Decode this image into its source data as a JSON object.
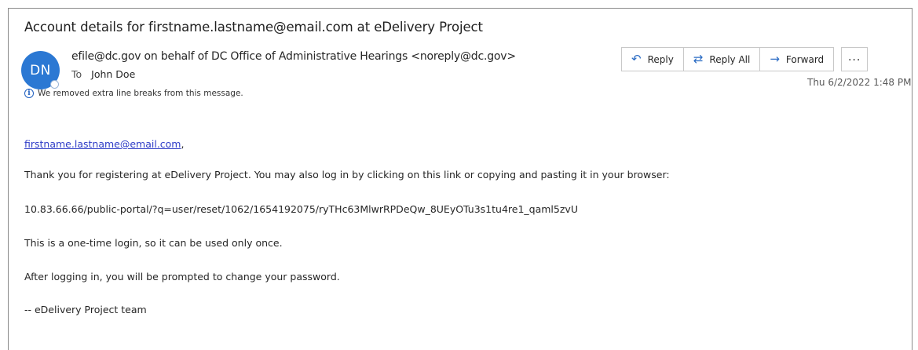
{
  "email": {
    "subject": "Account details for firstname.lastname@email.com at eDelivery Project",
    "avatar_initials": "DN",
    "sender": "efile@dc.gov on behalf of DC Office of Administrative Hearings <noreply@dc.gov>",
    "to_label": "To",
    "to_name": "John Doe",
    "notice": "We removed extra line breaks from this message.",
    "timestamp": "Thu 6/2/2022 1:48 PM"
  },
  "actions": {
    "reply_label": "Reply",
    "reply_all_label": "Reply All",
    "forward_label": "Forward",
    "more_label": "..."
  },
  "body": {
    "greeting_link": "firstname.lastname@email.com",
    "greeting_suffix": ",",
    "line1": "Thank you for registering at eDelivery Project. You may also log in by clicking on this link or copying and pasting it in your browser:",
    "login_url": "10.83.66.66/public-portal/?q=user/reset/1062/1654192075/ryTHc63MlwrRPDeQw_8UEyOTu3s1tu4re1_qaml5zvU",
    "line2": "This is a one-time login, so it can be used only once.",
    "line3": "After logging in, you will be prompted to change your password.",
    "signature": "--  eDelivery Project team"
  },
  "colors": {
    "avatar": "#2b78d3",
    "link": "#2e3cc7",
    "action_icon": "#2b6cc4"
  },
  "icons": {
    "reply": "reply-arrow-icon",
    "reply_all": "reply-all-icon",
    "forward": "forward-arrow-icon",
    "more": "more-options-icon",
    "info": "info-icon"
  }
}
